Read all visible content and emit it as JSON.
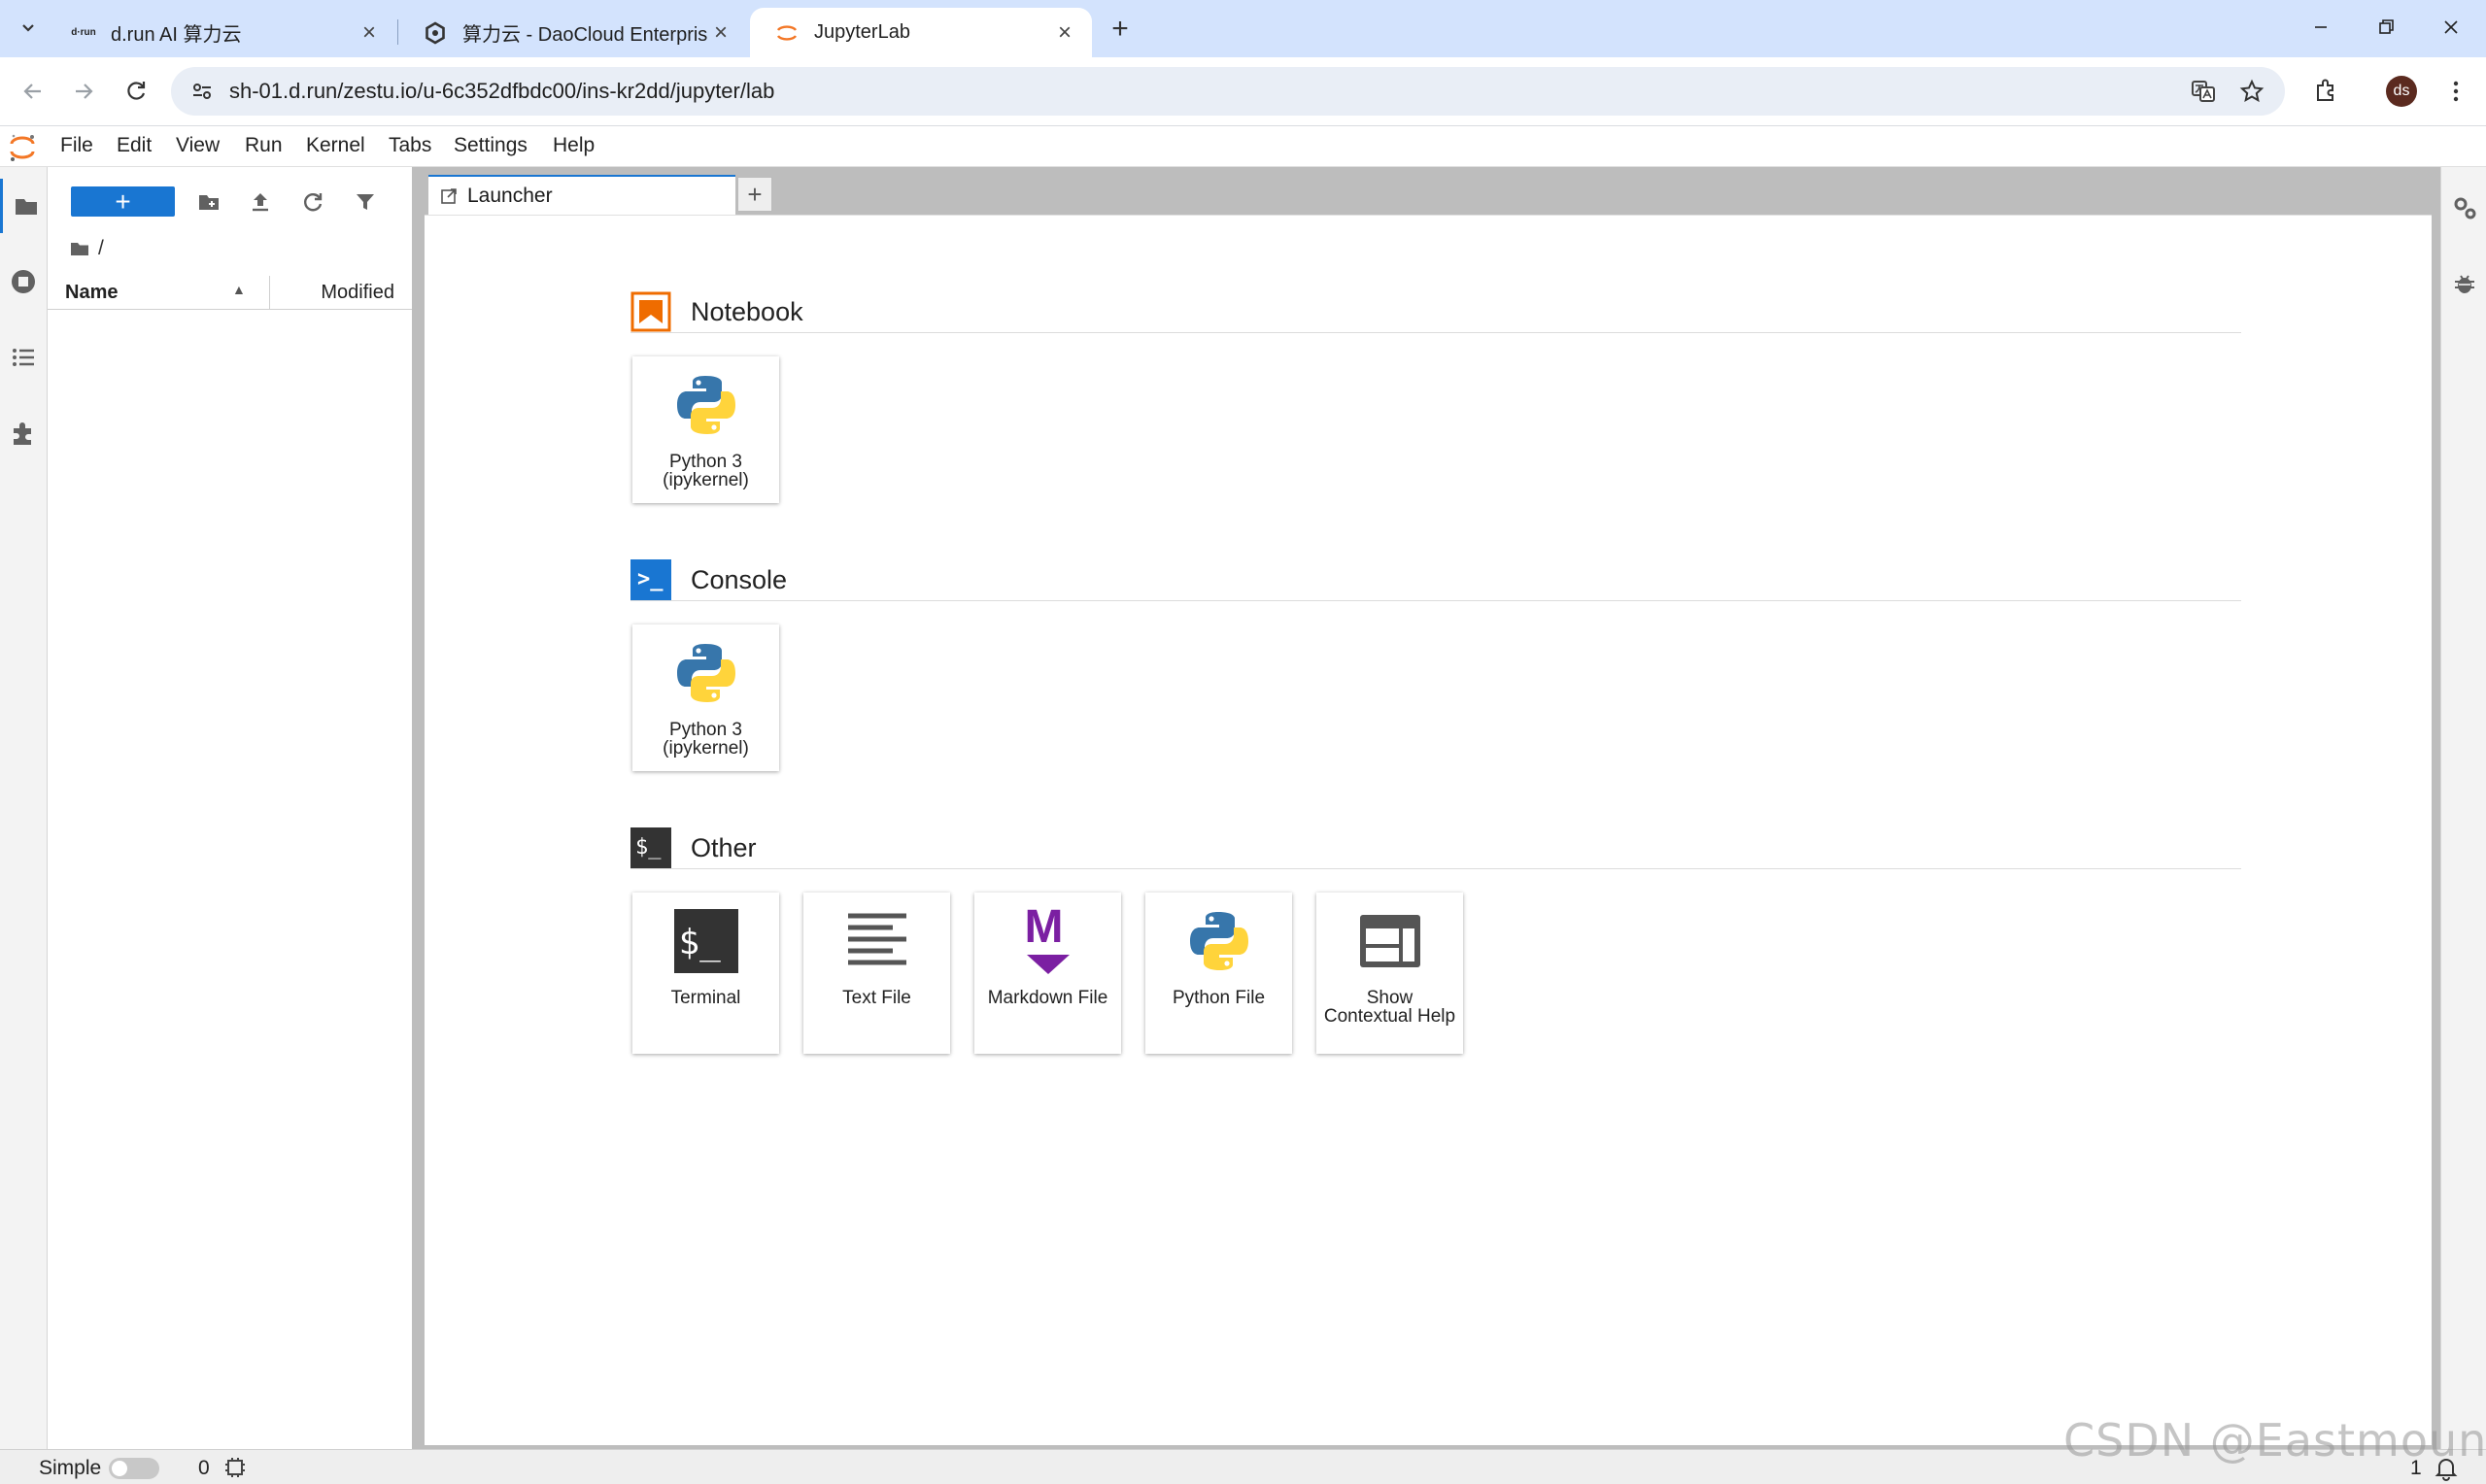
{
  "browser": {
    "tabs": [
      {
        "favicon": "drun-logo",
        "title": "d.run AI 算力云",
        "active": false
      },
      {
        "favicon": "daocloud-logo",
        "title": "算力云 - DaoCloud Enterprise",
        "active": false
      },
      {
        "favicon": "jupyter-logo",
        "title": "JupyterLab",
        "active": true
      }
    ],
    "url": "sh-01.d.run/zestu.io/u-6c352dfbdc00/ins-kr2dd/jupyter/lab",
    "avatar_initials": "ds",
    "drun_favicon_text": "d·run"
  },
  "menu": [
    "File",
    "Edit",
    "View",
    "Run",
    "Kernel",
    "Tabs",
    "Settings",
    "Help"
  ],
  "filebrowser": {
    "new_label": "+",
    "path": "/",
    "columns": {
      "name": "Name",
      "modified": "Modified"
    }
  },
  "dock": {
    "tab_label": "Launcher",
    "add_label": "+"
  },
  "launcher": {
    "notebook": {
      "title": "Notebook",
      "cards": [
        {
          "label": "Python 3\n(ipykernel)"
        }
      ]
    },
    "console": {
      "title": "Console",
      "icon_text": ">_",
      "cards": [
        {
          "label": "Python 3\n(ipykernel)"
        }
      ]
    },
    "other": {
      "title": "Other",
      "icon_text": "$_",
      "cards": [
        {
          "label": "Terminal",
          "icon": "terminal-icon",
          "icon_text": "$_"
        },
        {
          "label": "Text File",
          "icon": "text-file-icon"
        },
        {
          "label": "Markdown File",
          "icon": "markdown-icon",
          "icon_text": "M"
        },
        {
          "label": "Python File",
          "icon": "python-icon"
        },
        {
          "label": "Show Contextual Help",
          "icon": "contextual-help-icon"
        }
      ]
    }
  },
  "statusbar": {
    "mode_label": "Simple",
    "kernel_count": "0",
    "notifications": "1"
  },
  "watermark": "CSDN @Eastmount",
  "colors": {
    "accent": "#1976d2",
    "jupyter_orange": "#f37726",
    "markdown_purple": "#7b1fa2",
    "tab_strip": "#d3e3fd"
  }
}
